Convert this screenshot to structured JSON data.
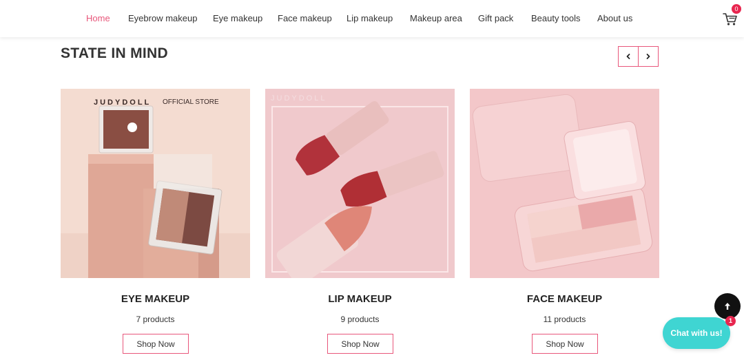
{
  "nav": {
    "items": [
      {
        "label": "Home",
        "active": true
      },
      {
        "label": "Eyebrow makeup",
        "active": false
      },
      {
        "label": "Eye makeup",
        "active": false
      },
      {
        "label": "Face makeup",
        "active": false
      },
      {
        "label": "Lip makeup",
        "active": false
      },
      {
        "label": "Makeup area",
        "active": false
      },
      {
        "label": "Gift pack",
        "active": false
      },
      {
        "label": "Beauty tools",
        "active": false
      },
      {
        "label": "About us",
        "active": false
      }
    ],
    "cart_count": "0",
    "cart_icon": "cart-icon"
  },
  "section": {
    "title": "STATE IN MIND",
    "prev_icon": "chevron-left-icon",
    "next_icon": "chevron-right-icon"
  },
  "cards": [
    {
      "title": "EYE MAKEUP",
      "count": "7 products",
      "button": "Shop Now",
      "image_brand": "JUDYDOLL",
      "image_store": "OFFICIAL STORE"
    },
    {
      "title": "LIP MAKEUP",
      "count": "9 products",
      "button": "Shop Now",
      "image_brand": "JUDYDOLL"
    },
    {
      "title": "FACE MAKEUP",
      "count": "11 products",
      "button": "Shop Now"
    }
  ],
  "floating": {
    "chat_label": "Chat with us!",
    "chat_badge": "1",
    "top_icon": "arrow-up-icon"
  },
  "colors": {
    "accent": "#e8567a",
    "badge": "#e8264f",
    "chat": "#3fd5d2"
  }
}
